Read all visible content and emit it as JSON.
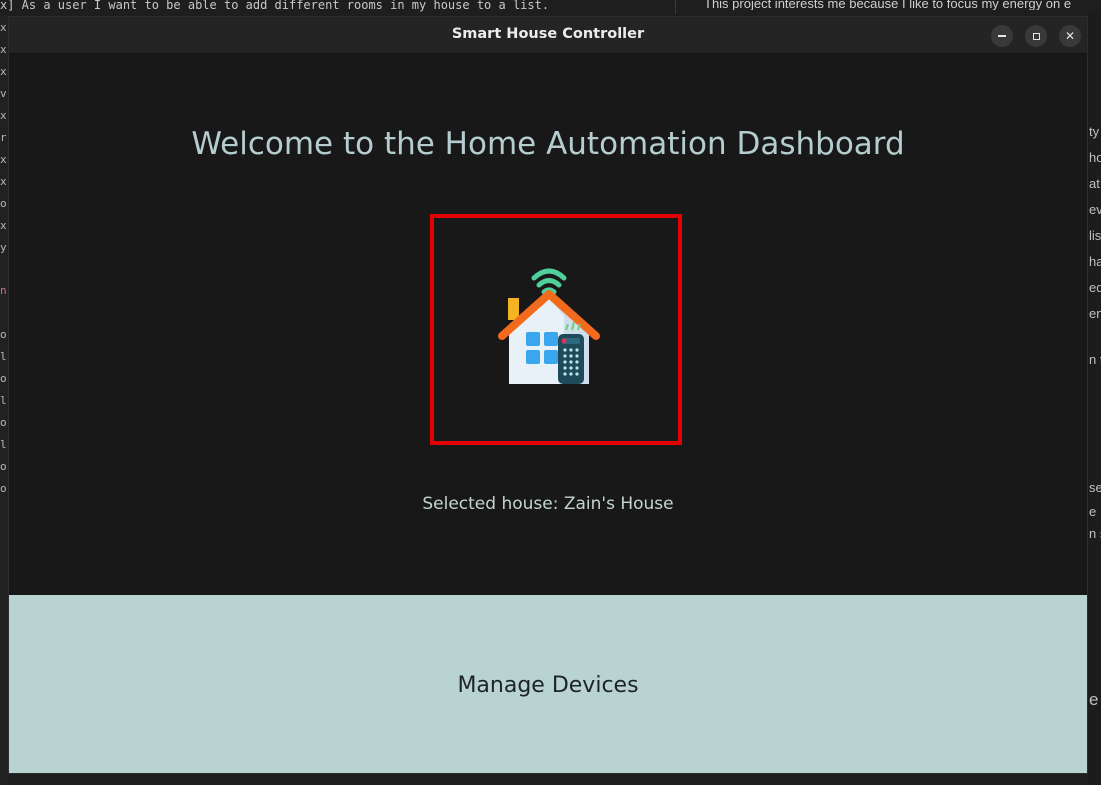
{
  "background": {
    "editor_line": "x] As a user I want to be able to add different rooms in my house to a list.",
    "doc_line": "This project interests me because I like to focus my energy on e",
    "left_gutter": [
      "x",
      "x",
      "x",
      "v:",
      "x",
      "r",
      "x",
      "x",
      "o",
      "x",
      "y",
      "n",
      "o",
      "l",
      "o",
      "l",
      "o",
      "l",
      "o",
      "o"
    ],
    "right_gutter": [
      "ty",
      "ho",
      "at",
      "evi",
      "list",
      "ha",
      "ed",
      "en",
      "n t",
      "se",
      "e",
      "n s",
      "e"
    ]
  },
  "window": {
    "title": "Smart House Controller",
    "controls": {
      "minimize_label": "minimize",
      "maximize_label": "maximize",
      "close_symbol": "✕"
    }
  },
  "main": {
    "welcome_heading": "Welcome to the Home Automation Dashboard",
    "logo_icon": "smart-home-remote-icon",
    "selected_house_text": "Selected house: Zain's House",
    "manage_button_label": "Manage Devices"
  },
  "colors": {
    "heading": "#b5cdcf",
    "highlight_border": "#e30000",
    "button_bg": "#b9d3d3",
    "window_bg": "#181818"
  }
}
